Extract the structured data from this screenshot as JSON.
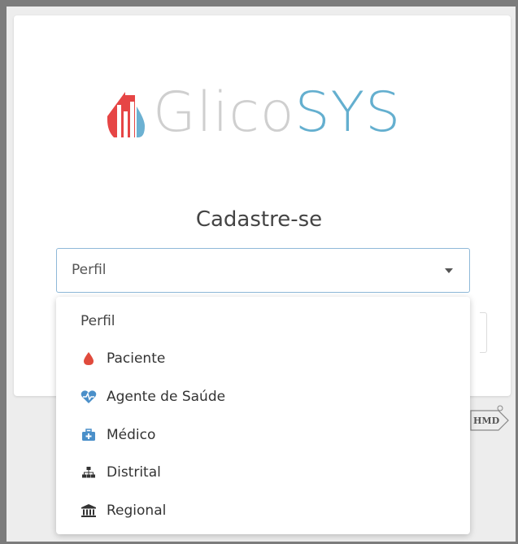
{
  "brand": {
    "name_light": "Glico",
    "name_accent": "SYS",
    "accent_color": "#64afcf",
    "flame_color": "#e64545",
    "drop_color": "#6cb1d2"
  },
  "register": {
    "title": "Cadastre-se"
  },
  "profile_select": {
    "selected_value": "Perfil",
    "caret_icon": "chevron-down-icon"
  },
  "dropdown": {
    "header": "Perfil",
    "options": [
      {
        "label": "Paciente",
        "icon": "blood-drop-icon",
        "icon_color": "#e04a3c"
      },
      {
        "label": "Agente de Saúde",
        "icon": "heartbeat-icon",
        "icon_color": "#4a8fc9"
      },
      {
        "label": "Médico",
        "icon": "medkit-icon",
        "icon_color": "#4a8fc9"
      },
      {
        "label": "Distrital",
        "icon": "sitemap-icon",
        "icon_color": "#333333"
      },
      {
        "label": "Regional",
        "icon": "institution-icon",
        "icon_color": "#333333"
      }
    ]
  },
  "footer": {
    "badge_text": "HMD"
  }
}
